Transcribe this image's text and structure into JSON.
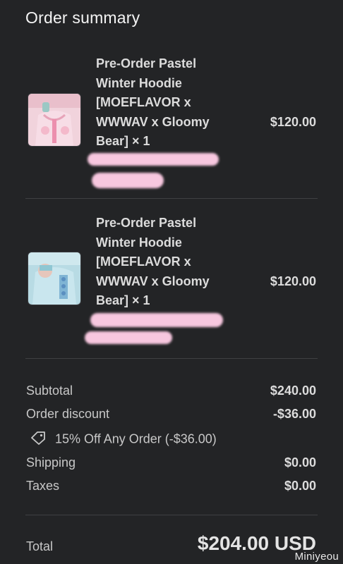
{
  "header": {
    "title": "Order summary"
  },
  "items": [
    {
      "name": "Pre-Order Pastel Winter Hoodie [MOEFLAVOR x WWWAV x Gloomy Bear] × 1",
      "price": "$120.00",
      "image": "pink-hoodie-product-photo"
    },
    {
      "name": "Pre-Order Pastel Winter Hoodie [MOEFLAVOR x WWWAV x Gloomy Bear] × 1",
      "price": "$120.00",
      "image": "blue-hoodie-product-photo"
    }
  ],
  "summary": {
    "subtotal_label": "Subtotal",
    "subtotal_value": "$240.00",
    "discount_label": "Order discount",
    "discount_value": "-$36.00",
    "discount_code": "15% Off Any Order (-$36.00)",
    "shipping_label": "Shipping",
    "shipping_value": "$0.00",
    "taxes_label": "Taxes",
    "taxes_value": "$0.00",
    "total_label": "Total",
    "total_value": "$204.00 USD"
  },
  "watermark": "Miniyeou",
  "colors": {
    "background": "#232426",
    "redaction": "#f7c7df",
    "text_primary": "#dcdcdc"
  }
}
